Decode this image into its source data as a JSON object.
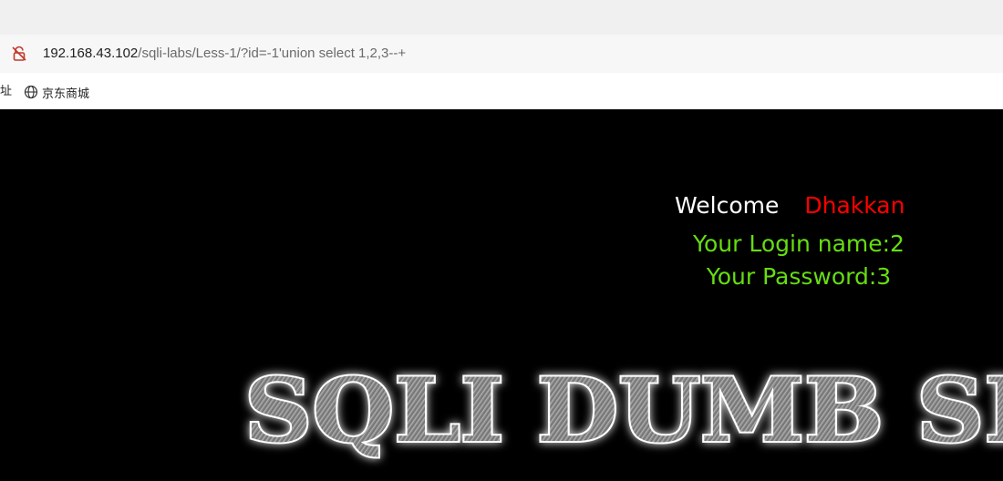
{
  "browser": {
    "url_host": "192.168.43.102",
    "url_path": "/sqli-labs/Less-1/?id=-1'union select 1,2,3--+",
    "security_icon": "insecure-lock-icon",
    "bookmarks": {
      "partial_item": "址",
      "items": [
        {
          "label": "京东商城",
          "icon": "globe-icon"
        }
      ]
    }
  },
  "page": {
    "welcome_label": "Welcome",
    "user_name": "Dhakkan",
    "login_name_line": "Your Login name:2",
    "password_line": "Your Password:3",
    "banner_text": "SQLI DUMB SE",
    "colors": {
      "background": "#000000",
      "welcome": "#ffffff",
      "user_name": "#ff0000",
      "info": "#66dd11"
    }
  }
}
